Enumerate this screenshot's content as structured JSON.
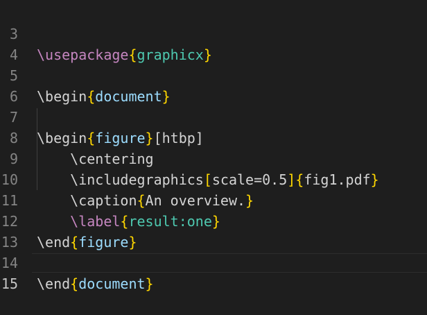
{
  "editor": {
    "language": "latex",
    "colors": {
      "background": "#1e1e1e",
      "line_number": "#858585",
      "line_number_active": "#c6c6c6",
      "default_text": "#d4d4d4",
      "command_magenta": "#c586c0",
      "brace_gold": "#ffd700",
      "package_teal": "#4ec9b0",
      "argument_blue": "#9cdcfe"
    },
    "lines": [
      {
        "number": "3",
        "tokens": [
          "\\usepackage",
          "{",
          "graphicx",
          "}"
        ]
      },
      {
        "number": "4",
        "tokens": []
      },
      {
        "number": "5",
        "tokens": [
          "\\begin",
          "{",
          "document",
          "}"
        ]
      },
      {
        "number": "6",
        "tokens": []
      },
      {
        "number": "7",
        "tokens": [
          "\\begin",
          "{",
          "figure",
          "}",
          "[htbp]"
        ]
      },
      {
        "number": "8",
        "tokens": [
          "    ",
          "\\centering"
        ]
      },
      {
        "number": "9",
        "tokens": [
          "    ",
          "\\includegraphics",
          "[",
          "scale=0.5",
          "]",
          "{",
          "fig1.pdf",
          "}"
        ]
      },
      {
        "number": "10",
        "tokens": [
          "    ",
          "\\caption",
          "{",
          "An overview.",
          "}"
        ]
      },
      {
        "number": "11",
        "tokens": [
          "    ",
          "\\label",
          "{",
          "result:one",
          "}"
        ]
      },
      {
        "number": "12",
        "tokens": [
          "\\end",
          "{",
          "figure",
          "}"
        ]
      },
      {
        "number": "13",
        "tokens": []
      },
      {
        "number": "14",
        "tokens": [
          "\\end",
          "{",
          "document",
          "}"
        ]
      },
      {
        "number": "15",
        "tokens": []
      }
    ],
    "active_line": "15"
  }
}
